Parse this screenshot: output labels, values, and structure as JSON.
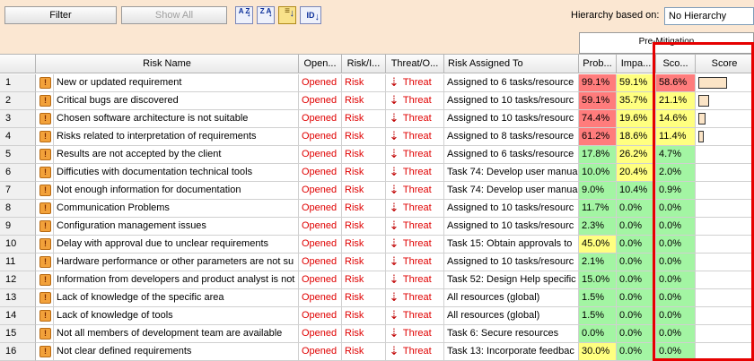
{
  "toolbar": {
    "filter_label": "Filter",
    "show_all_label": "Show All",
    "sort_az_label": "A Z",
    "sort_za_label": "Z A",
    "id_label": "ID",
    "hierarchy_label": "Hierarchy based on:",
    "hierarchy_value": "No Hierarchy"
  },
  "pre_mitigation_label": "Pre-Mitigation",
  "columns": {
    "risk_name": "Risk Name",
    "opened": "Open...",
    "risk_type": "Risk/I...",
    "threat": "Threat/O...",
    "assigned": "Risk Assigned To",
    "prob": "Prob...",
    "impact": "Impa...",
    "score": "Sco...",
    "score_bar": "Score"
  },
  "rows": [
    {
      "num": "1",
      "name": "New or updated requirement",
      "status": "Opened",
      "type": "Risk",
      "threat": "Threat",
      "assigned": "Assigned to 6 tasks/resource",
      "prob": "99.1%",
      "impact": "59.1%",
      "score": "58.6%",
      "prob_color": "red",
      "impact_color": "yellow",
      "score_color": "red",
      "bar": 0.586
    },
    {
      "num": "2",
      "name": "Critical bugs are discovered",
      "status": "Opened",
      "type": "Risk",
      "threat": "Threat",
      "assigned": "Assigned to 10 tasks/resourc",
      "prob": "59.1%",
      "impact": "35.7%",
      "score": "21.1%",
      "prob_color": "red",
      "impact_color": "yellow",
      "score_color": "yellow",
      "bar": 0.211
    },
    {
      "num": "3",
      "name": "Chosen software architecture is not suitable",
      "status": "Opened",
      "type": "Risk",
      "threat": "Threat",
      "assigned": "Assigned to 10 tasks/resourc",
      "prob": "74.4%",
      "impact": "19.6%",
      "score": "14.6%",
      "prob_color": "red",
      "impact_color": "yellow",
      "score_color": "yellow",
      "bar": 0.146
    },
    {
      "num": "4",
      "name": "Risks related to interpretation of requirements",
      "status": "Opened",
      "type": "Risk",
      "threat": "Threat",
      "assigned": "Assigned to 8 tasks/resource",
      "prob": "61.2%",
      "impact": "18.6%",
      "score": "11.4%",
      "prob_color": "red",
      "impact_color": "yellow",
      "score_color": "yellow",
      "bar": 0.114
    },
    {
      "num": "5",
      "name": "Results are not accepted by the client",
      "status": "Opened",
      "type": "Risk",
      "threat": "Threat",
      "assigned": "Assigned to 6 tasks/resource",
      "prob": "17.8%",
      "impact": "26.2%",
      "score": "4.7%",
      "prob_color": "green",
      "impact_color": "yellow",
      "score_color": "green",
      "bar": 0
    },
    {
      "num": "6",
      "name": "Difficuties with documentation technical tools",
      "status": "Opened",
      "type": "Risk",
      "threat": "Threat",
      "assigned": "Task 74: Develop user manua",
      "prob": "10.0%",
      "impact": "20.4%",
      "score": "2.0%",
      "prob_color": "green",
      "impact_color": "yellow",
      "score_color": "green",
      "bar": 0
    },
    {
      "num": "7",
      "name": "Not enough information for documentation",
      "status": "Opened",
      "type": "Risk",
      "threat": "Threat",
      "assigned": "Task 74: Develop user manua",
      "prob": "9.0%",
      "impact": "10.4%",
      "score": "0.9%",
      "prob_color": "green",
      "impact_color": "green",
      "score_color": "green",
      "bar": 0
    },
    {
      "num": "8",
      "name": "Communication Problems",
      "status": "Opened",
      "type": "Risk",
      "threat": "Threat",
      "assigned": "Assigned to 10 tasks/resourc",
      "prob": "11.7%",
      "impact": "0.0%",
      "score": "0.0%",
      "prob_color": "green",
      "impact_color": "green",
      "score_color": "green",
      "bar": 0
    },
    {
      "num": "9",
      "name": "Configuration management issues",
      "status": "Opened",
      "type": "Risk",
      "threat": "Threat",
      "assigned": "Assigned to 10 tasks/resourc",
      "prob": "2.3%",
      "impact": "0.0%",
      "score": "0.0%",
      "prob_color": "green",
      "impact_color": "green",
      "score_color": "green",
      "bar": 0
    },
    {
      "num": "10",
      "name": "Delay with approval due to unclear requirements",
      "status": "Opened",
      "type": "Risk",
      "threat": "Threat",
      "assigned": "Task 15: Obtain approvals to",
      "prob": "45.0%",
      "impact": "0.0%",
      "score": "0.0%",
      "prob_color": "yellow",
      "impact_color": "green",
      "score_color": "green",
      "bar": 0
    },
    {
      "num": "11",
      "name": "Hardware performance or other parameters are not su",
      "status": "Opened",
      "type": "Risk",
      "threat": "Threat",
      "assigned": "Assigned to 10 tasks/resourc",
      "prob": "2.1%",
      "impact": "0.0%",
      "score": "0.0%",
      "prob_color": "green",
      "impact_color": "green",
      "score_color": "green",
      "bar": 0
    },
    {
      "num": "12",
      "name": "Information from developers and product analyst is not",
      "status": "Opened",
      "type": "Risk",
      "threat": "Threat",
      "assigned": "Task 52: Design Help specific",
      "prob": "15.0%",
      "impact": "0.0%",
      "score": "0.0%",
      "prob_color": "green",
      "impact_color": "green",
      "score_color": "green",
      "bar": 0
    },
    {
      "num": "13",
      "name": "Lack of knowledge of the specific area",
      "status": "Opened",
      "type": "Risk",
      "threat": "Threat",
      "assigned": "All resources (global)",
      "prob": "1.5%",
      "impact": "0.0%",
      "score": "0.0%",
      "prob_color": "green",
      "impact_color": "green",
      "score_color": "green",
      "bar": 0
    },
    {
      "num": "14",
      "name": "Lack of knowledge of tools",
      "status": "Opened",
      "type": "Risk",
      "threat": "Threat",
      "assigned": "All resources (global)",
      "prob": "1.5%",
      "impact": "0.0%",
      "score": "0.0%",
      "prob_color": "green",
      "impact_color": "green",
      "score_color": "green",
      "bar": 0
    },
    {
      "num": "15",
      "name": "Not all members of development team are available",
      "status": "Opened",
      "type": "Risk",
      "threat": "Threat",
      "assigned": "Task 6: Secure resources",
      "prob": "0.0%",
      "impact": "0.0%",
      "score": "0.0%",
      "prob_color": "green",
      "impact_color": "green",
      "score_color": "green",
      "bar": 0
    },
    {
      "num": "16",
      "name": "Not clear defined requirements",
      "status": "Opened",
      "type": "Risk",
      "threat": "Threat",
      "assigned": "Task 13: Incorporate feedbac",
      "prob": "30.0%",
      "impact": "0.0%",
      "score": "0.0%",
      "prob_color": "yellow",
      "impact_color": "green",
      "score_color": "green",
      "bar": 0
    }
  ]
}
